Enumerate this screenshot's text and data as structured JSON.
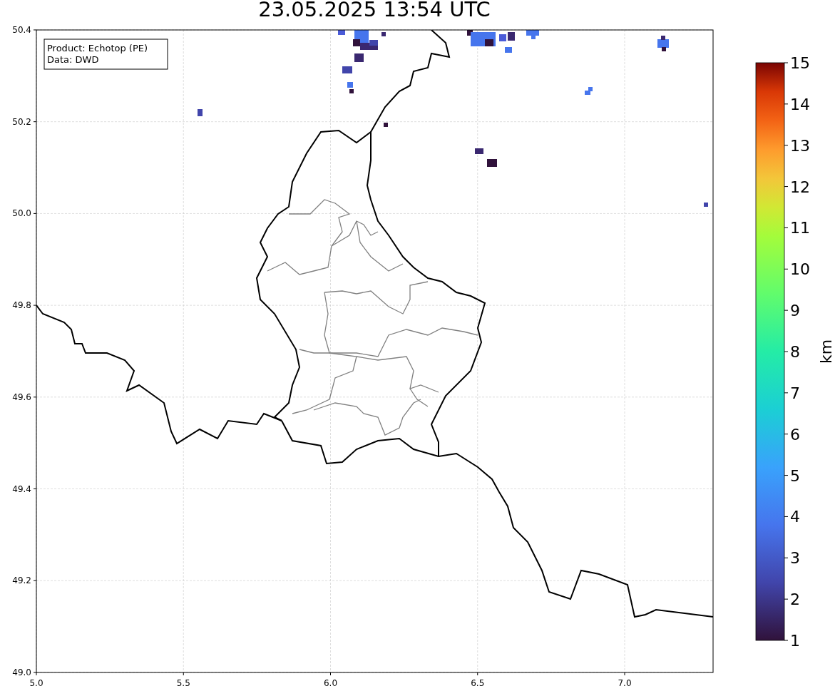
{
  "title": "23.05.2025 13:54 UTC",
  "info_box": [
    "Product: Echotop (PE)",
    "Data: DWD"
  ],
  "map": {
    "xticks": [
      "5.0",
      "5.5",
      "6.0",
      "6.5",
      "7.0"
    ],
    "yticks": [
      "50.4",
      "50.2",
      "50.0",
      "49.8",
      "49.6",
      "49.4",
      "49.2",
      "49.0"
    ]
  },
  "colorbar": {
    "label": "km",
    "ticks": [
      "15",
      "14",
      "13",
      "12",
      "11",
      "10",
      "9",
      "8",
      "7",
      "6",
      "5",
      "4",
      "3",
      "2",
      "1"
    ]
  }
}
